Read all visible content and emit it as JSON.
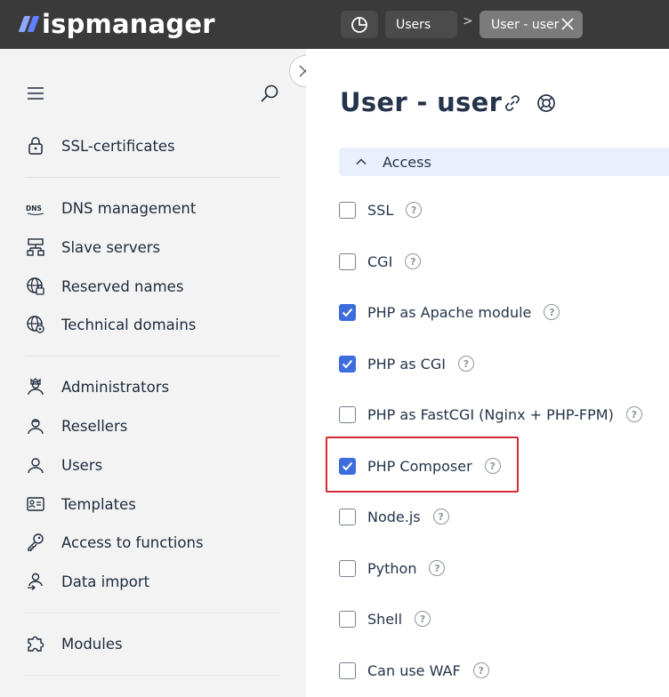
{
  "header": {
    "logo_text": "ispmanager",
    "breadcrumb": {
      "dashboard_icon": "dashboard-icon",
      "tab_users": "Users",
      "separator": ">",
      "tab_active": "User - user"
    }
  },
  "sidebar": {
    "menu_icon": "hamburger-icon",
    "search_icon": "search-icon",
    "groups": [
      [
        {
          "label": "SSL-certificates",
          "icon": "lock-icon"
        }
      ],
      [
        {
          "label": "DNS management",
          "icon": "dns-icon"
        },
        {
          "label": "Slave servers",
          "icon": "servers-icon"
        },
        {
          "label": "Reserved names",
          "icon": "globe-lock-icon"
        },
        {
          "label": "Technical domains",
          "icon": "globe-gear-icon"
        }
      ],
      [
        {
          "label": "Administrators",
          "icon": "admin-icon"
        },
        {
          "label": "Resellers",
          "icon": "reseller-icon"
        },
        {
          "label": "Users",
          "icon": "user-icon"
        },
        {
          "label": "Templates",
          "icon": "template-icon"
        },
        {
          "label": "Access to functions",
          "icon": "key-icon"
        },
        {
          "label": "Data import",
          "icon": "import-icon"
        }
      ],
      [
        {
          "label": "Modules",
          "icon": "puzzle-icon"
        }
      ]
    ]
  },
  "main": {
    "title": "User - user",
    "section": {
      "label": "Access",
      "expanded": true
    },
    "options": [
      {
        "label": "SSL",
        "checked": false
      },
      {
        "label": "CGI",
        "checked": false
      },
      {
        "label": "PHP as Apache module",
        "checked": true
      },
      {
        "label": "PHP as CGI",
        "checked": true
      },
      {
        "label": "PHP as FastCGI (Nginx + PHP-FPM)",
        "checked": false
      },
      {
        "label": "PHP Composer",
        "checked": true
      },
      {
        "label": "Node.js",
        "checked": false
      },
      {
        "label": "Python",
        "checked": false
      },
      {
        "label": "Shell",
        "checked": false
      },
      {
        "label": "Can use WAF",
        "checked": false
      }
    ],
    "help_glyph": "?"
  },
  "colors": {
    "topbar": "#3a3a3a",
    "accent": "#3d6ddd",
    "highlight": "#d02c34",
    "section_bg": "#eaeffc"
  }
}
